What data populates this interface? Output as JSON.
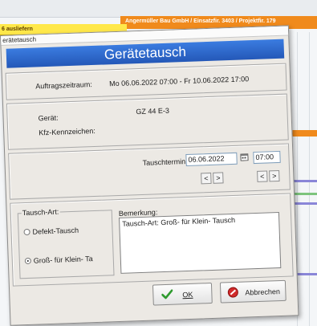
{
  "background": {
    "left_bar_text": "6 ausliefern",
    "right_bar_text": "Angermüller Bau GmbH / Einsatzfir. 3403 / Projektfir. 179",
    "colors": {
      "yellow_bar": "#ffe84a",
      "orange_bar": "#f08a1c"
    }
  },
  "dialog": {
    "window_title": "erätetausch",
    "header": "Gerätetausch",
    "header_color": "#2f6fd0",
    "order_period": {
      "label": "Auftragszeitraum:",
      "value": "Mo 06.06.2022 07:00 - Fr 10.06.2022 17:00"
    },
    "device": {
      "label": "Gerät:",
      "value": "GZ 44 E-3",
      "plate_label": "Kfz-Kennzeichen:",
      "plate_value": ""
    },
    "exchange_date": {
      "label": "Tauschtermin",
      "date": "06.06.2022",
      "time": "07:00",
      "calendar_icon": "calendar-icon",
      "date_prev": "<",
      "date_next": ">",
      "time_prev": "<",
      "time_next": ">"
    },
    "exchange_type": {
      "legend": "Tausch-Art:",
      "options": [
        {
          "label": "Defekt-Tausch",
          "selected": false
        },
        {
          "label": "Groß- für Klein- Ta",
          "selected": true
        }
      ]
    },
    "remarks": {
      "label": "Bemerkung:",
      "value": "Tausch-Art: Groß- für Klein- Tausch"
    },
    "buttons": {
      "ok": "OK",
      "cancel": "Abbrechen",
      "ok_icon": "checkmark-icon",
      "cancel_icon": "cancel-icon"
    }
  }
}
